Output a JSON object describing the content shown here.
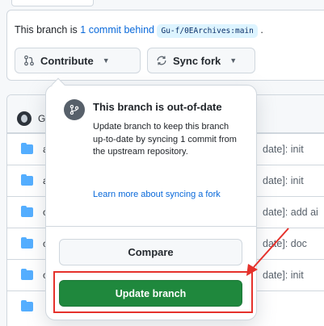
{
  "status": {
    "prefix": "This branch is ",
    "behind_link": "1 commit behind",
    "upstream_ref": "Gu-f/0EArchives:main",
    "suffix": " ."
  },
  "actions": {
    "contribute_label": "Contribute",
    "sync_label": "Sync fork"
  },
  "files": {
    "owner_initial": "G",
    "rows": [
      {
        "name": "a",
        "commit": "date]: init"
      },
      {
        "name": "a",
        "commit": "date]: init"
      },
      {
        "name": "c",
        "commit": "date]: add ai"
      },
      {
        "name": "c",
        "commit": "date]: doc"
      },
      {
        "name": "c",
        "commit": "date]: init"
      }
    ]
  },
  "popover": {
    "title": "This branch is out-of-date",
    "body": "Update branch to keep this branch up-to-date by syncing 1 commit from the upstream repository.",
    "learn_more": "Learn more about syncing a fork",
    "compare_label": "Compare",
    "update_label": "Update branch"
  },
  "colors": {
    "accent_green": "#1f883d",
    "link_blue": "#0969da",
    "annotation_red": "#e5312b",
    "folder_blue": "#54aeff"
  }
}
